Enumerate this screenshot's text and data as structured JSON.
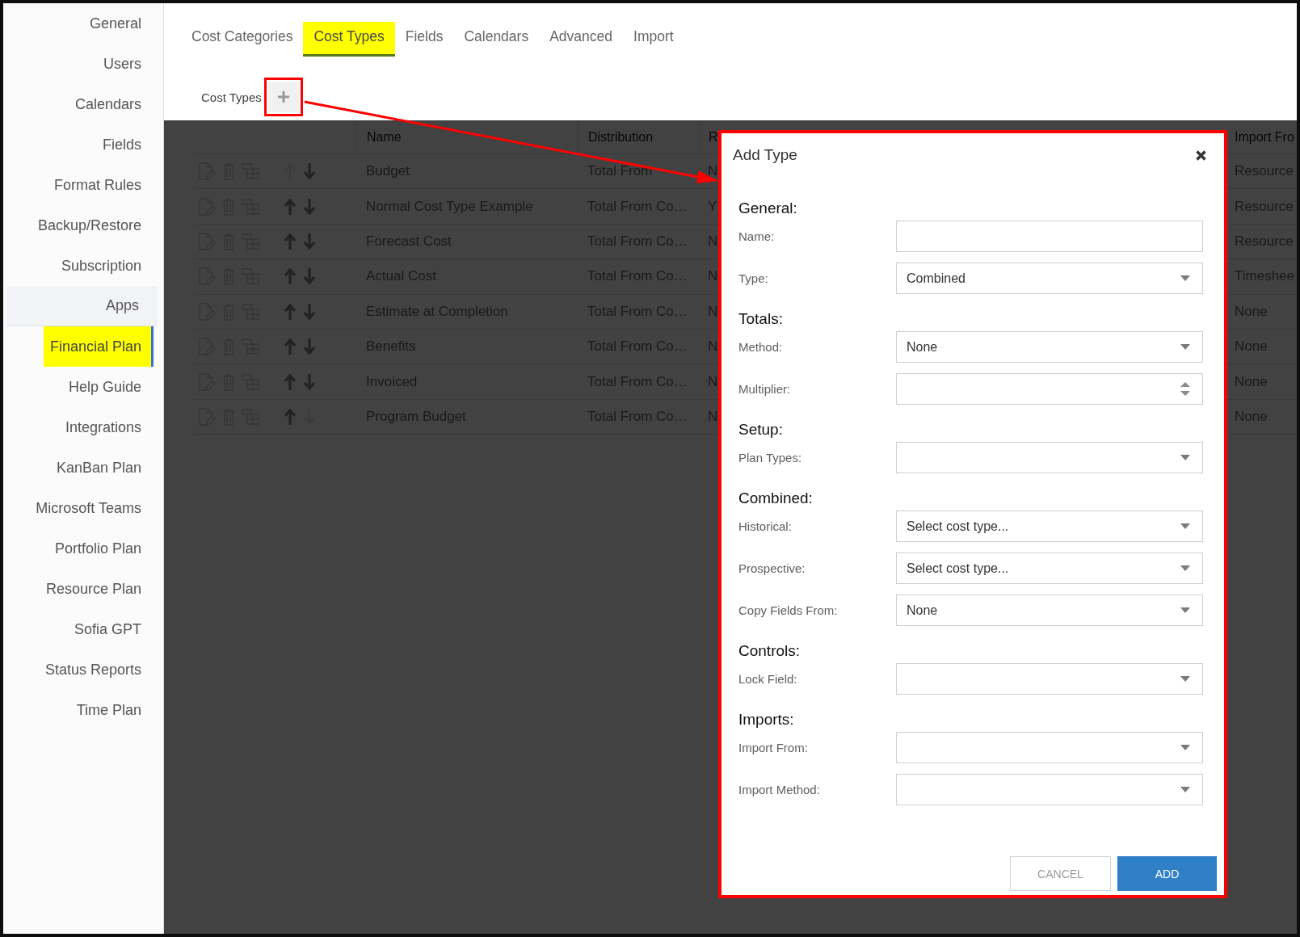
{
  "sidebar": {
    "items": [
      {
        "label": "General",
        "selected": false,
        "highlighted": false
      },
      {
        "label": "Users",
        "selected": false,
        "highlighted": false
      },
      {
        "label": "Calendars",
        "selected": false,
        "highlighted": false
      },
      {
        "label": "Fields",
        "selected": false,
        "highlighted": false
      },
      {
        "label": "Format Rules",
        "selected": false,
        "highlighted": false
      },
      {
        "label": "Backup/Restore",
        "selected": false,
        "highlighted": false
      },
      {
        "label": "Subscription",
        "selected": false,
        "highlighted": false
      },
      {
        "label": "Apps",
        "selected": false,
        "highlighted": false,
        "expanded": true,
        "children": [
          {
            "label": "Financial Plan",
            "selected": true,
            "highlighted": true
          },
          {
            "label": "Help Guide",
            "selected": false,
            "highlighted": false
          },
          {
            "label": "Integrations",
            "selected": false,
            "highlighted": false
          },
          {
            "label": "KanBan Plan",
            "selected": false,
            "highlighted": false
          },
          {
            "label": "Microsoft Teams",
            "selected": false,
            "highlighted": false
          },
          {
            "label": "Portfolio Plan",
            "selected": false,
            "highlighted": false
          },
          {
            "label": "Resource Plan",
            "selected": false,
            "highlighted": false
          },
          {
            "label": "Sofia GPT",
            "selected": false,
            "highlighted": false
          },
          {
            "label": "Status Reports",
            "selected": false,
            "highlighted": false
          },
          {
            "label": "Time Plan",
            "selected": false,
            "highlighted": false
          }
        ]
      }
    ]
  },
  "tabs": [
    {
      "label": "Cost Categories",
      "selected": false,
      "highlighted": false
    },
    {
      "label": "Cost Types",
      "selected": true,
      "highlighted": true
    },
    {
      "label": "Fields",
      "selected": false,
      "highlighted": false
    },
    {
      "label": "Calendars",
      "selected": false,
      "highlighted": false
    },
    {
      "label": "Advanced",
      "selected": false,
      "highlighted": false
    },
    {
      "label": "Import",
      "selected": false,
      "highlighted": false
    }
  ],
  "toolbar": {
    "label": "Cost Types",
    "add_button": {
      "annotated": true
    }
  },
  "table": {
    "columns": [
      {
        "label": "Name"
      },
      {
        "label": "Distribution"
      },
      {
        "label": "R"
      },
      {
        "label": "Import Fro"
      }
    ],
    "rows": [
      {
        "cells": [
          "Budget",
          "Total From",
          "N",
          "Resource"
        ],
        "up_disabled": true,
        "down_disabled": false
      },
      {
        "cells": [
          "Normal Cost Type Example",
          "Total From Co…",
          "Y",
          "Resource"
        ],
        "up_disabled": false,
        "down_disabled": false
      },
      {
        "cells": [
          "Forecast Cost",
          "Total From Co…",
          "N",
          "Resource"
        ],
        "up_disabled": false,
        "down_disabled": false
      },
      {
        "cells": [
          "Actual Cost",
          "Total From Co…",
          "N",
          "Timeshee"
        ],
        "up_disabled": false,
        "down_disabled": false
      },
      {
        "cells": [
          "Estimate at Completion",
          "Total From Co…",
          "N",
          "None"
        ],
        "up_disabled": false,
        "down_disabled": false
      },
      {
        "cells": [
          "Benefits",
          "Total From Co…",
          "N",
          "None"
        ],
        "up_disabled": false,
        "down_disabled": false
      },
      {
        "cells": [
          "Invoiced",
          "Total From Co…",
          "N",
          "None"
        ],
        "up_disabled": false,
        "down_disabled": false
      },
      {
        "cells": [
          "Program Budget",
          "Total From Co…",
          "N",
          "None"
        ],
        "up_disabled": false,
        "down_disabled": true
      }
    ]
  },
  "dialog": {
    "title": "Add Type",
    "annotated": true,
    "sections": [
      {
        "heading": "General:",
        "fields": [
          {
            "label": "Name:",
            "kind": "text"
          },
          {
            "label": "Type:",
            "kind": "select",
            "value": "Combined"
          }
        ]
      },
      {
        "heading": "Totals:",
        "fields": [
          {
            "label": "Method:",
            "kind": "select",
            "value": "None"
          },
          {
            "label": "Multiplier:",
            "kind": "number"
          }
        ]
      },
      {
        "heading": "Setup:",
        "fields": [
          {
            "label": "Plan Types:",
            "kind": "select"
          }
        ]
      },
      {
        "heading": "Combined:",
        "fields": [
          {
            "label": "Historical:",
            "kind": "select",
            "placeholder": "Select cost type..."
          },
          {
            "label": "Prospective:",
            "kind": "select",
            "placeholder": "Select cost type..."
          },
          {
            "label": "Copy Fields From:",
            "kind": "select",
            "value": "None"
          }
        ]
      },
      {
        "heading": "Controls:",
        "fields": [
          {
            "label": "Lock Field:",
            "kind": "select"
          }
        ]
      },
      {
        "heading": "Imports:",
        "fields": [
          {
            "label": "Import From:",
            "kind": "select"
          },
          {
            "label": "Import Method:",
            "kind": "select"
          }
        ]
      }
    ],
    "buttons": [
      {
        "label": "CANCEL",
        "kind": "secondary"
      },
      {
        "label": "ADD",
        "kind": "primary"
      }
    ]
  }
}
